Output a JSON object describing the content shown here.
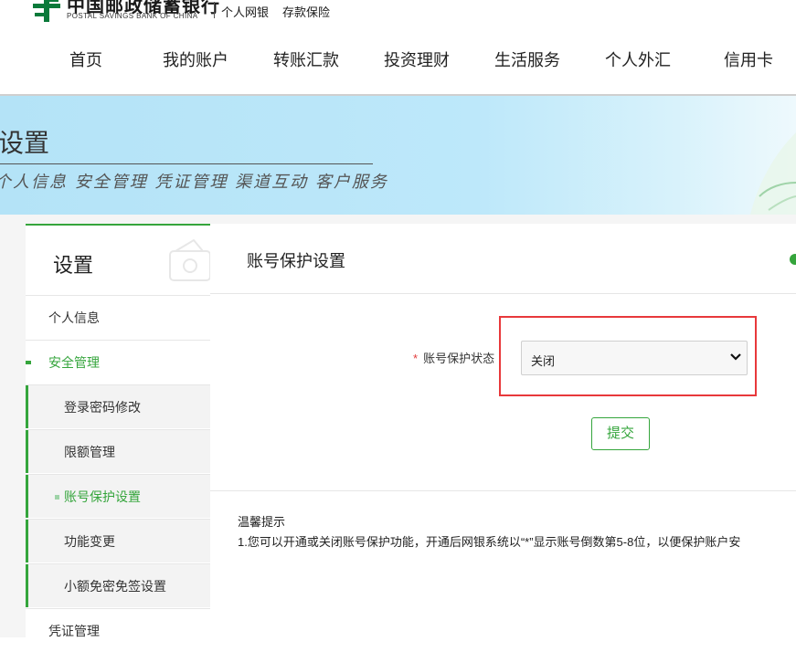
{
  "header": {
    "bank_name_cn": "中国邮政储蓄银行",
    "bank_name_en": "POSTAL SAVINGS BANK OF CHINA",
    "channel": "个人网银",
    "insurance": "存款保险"
  },
  "nav": {
    "items": [
      {
        "label": "首页"
      },
      {
        "label": "我的账户"
      },
      {
        "label": "转账汇款"
      },
      {
        "label": "投资理财"
      },
      {
        "label": "生活服务"
      },
      {
        "label": "个人外汇"
      },
      {
        "label": "信用卡"
      }
    ]
  },
  "banner": {
    "title": "设置",
    "slogan": "个人信息 安全管理 凭证管理 渠道互动 客户服务"
  },
  "sidebar": {
    "title": "设置",
    "items": [
      {
        "label": "个人信息",
        "level": 1
      },
      {
        "label": "安全管理",
        "level": 1,
        "active": true
      },
      {
        "label": "登录密码修改",
        "level": 2
      },
      {
        "label": "限额管理",
        "level": 2
      },
      {
        "label": "账号保护设置",
        "level": 2,
        "active": true
      },
      {
        "label": "功能变更",
        "level": 2
      },
      {
        "label": "小额免密免签设置",
        "level": 2
      },
      {
        "label": "凭证管理",
        "level": 1
      }
    ]
  },
  "main": {
    "title": "账号保护设置",
    "form": {
      "required_mark": "*",
      "status_label": "账号保护状态",
      "status_value": "关闭",
      "submit_label": "提交"
    },
    "tips": {
      "title": "温馨提示",
      "line1": "1.您可以开通或关闭账号保护功能，开通后网银系统以“*”显示账号倒数第5-8位，以便保护账户安"
    }
  },
  "colors": {
    "accent_green": "#35a53c",
    "highlight_red": "#e8383b",
    "banner_blue": "#bde8fa"
  }
}
